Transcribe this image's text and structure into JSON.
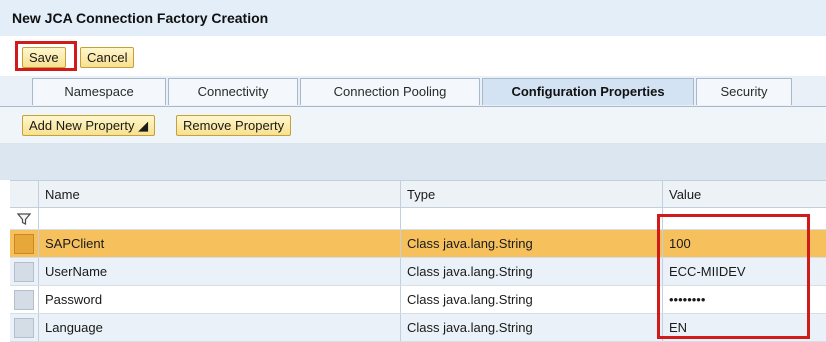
{
  "window": {
    "title": "New JCA Connection Factory Creation"
  },
  "toolbar": {
    "save_label": "Save",
    "cancel_label": "Cancel"
  },
  "tabs": [
    {
      "label": "Namespace"
    },
    {
      "label": "Connectivity"
    },
    {
      "label": "Connection Pooling"
    },
    {
      "label": "Configuration Properties",
      "active": true
    },
    {
      "label": "Security"
    }
  ],
  "actions": {
    "add_property_label": "Add New Property ◢",
    "remove_property_label": "Remove Property"
  },
  "table": {
    "columns": [
      "Name",
      "Type",
      "Value"
    ],
    "rows": [
      {
        "name": "SAPClient",
        "type": "Class java.lang.String",
        "value": "100",
        "selected": true
      },
      {
        "name": "UserName",
        "type": "Class java.lang.String",
        "value": "ECC-MIIDEV"
      },
      {
        "name": "Password",
        "type": "Class java.lang.String",
        "value": "••••••••"
      },
      {
        "name": "Language",
        "type": "Class java.lang.String",
        "value": "EN"
      }
    ]
  },
  "icons": {
    "filter": "filter-icon"
  },
  "colors": {
    "highlight_red": "#d11b1b",
    "selected_row": "#f6c15d",
    "tab_active": "#d3e3f3"
  }
}
